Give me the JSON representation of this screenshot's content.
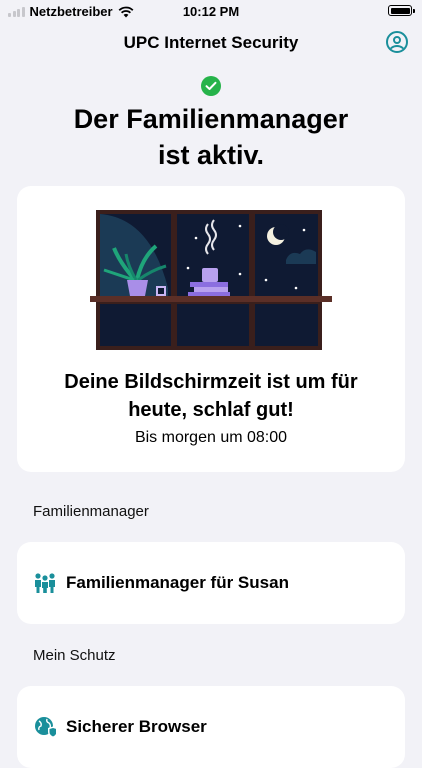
{
  "status_bar": {
    "carrier": "Netzbetreiber",
    "time": "10:12 PM"
  },
  "nav": {
    "title": "UPC Internet Security",
    "account_icon": "person-circle-icon"
  },
  "status": {
    "headline_line1": "Der Familienmanager",
    "headline_line2": "ist aktiv.",
    "badge_color": "#26b34a"
  },
  "hero": {
    "title_line1": "Deine Bildschirmzeit ist um für",
    "title_line2": "heute, schlaf gut!",
    "subtitle": "Bis morgen um 08:00"
  },
  "sections": [
    {
      "label": "Familienmanager",
      "item": "Familienmanager für Susan",
      "icon": "family-icon"
    },
    {
      "label": "Mein Schutz",
      "item": "Sicherer Browser",
      "icon": "globe-shield-icon"
    }
  ],
  "colors": {
    "accent": "#1a8f9b",
    "background": "#f2f2f7"
  }
}
